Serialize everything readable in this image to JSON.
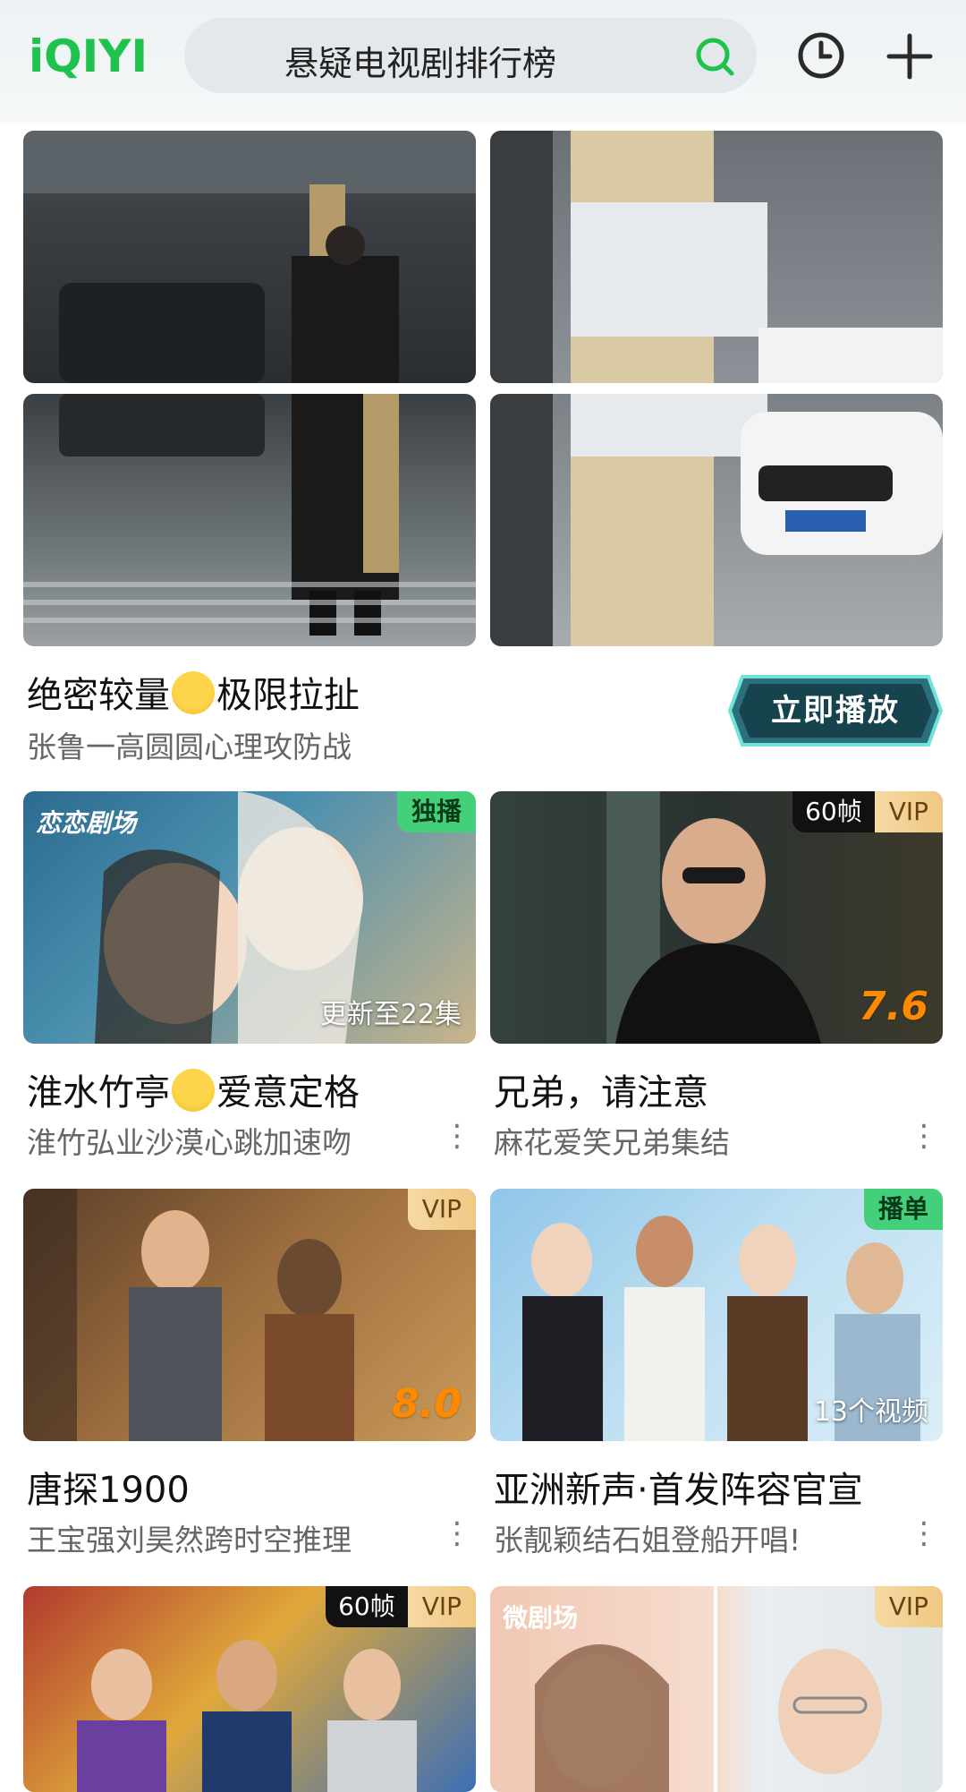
{
  "header": {
    "logo": "iQIYI",
    "search_text": "悬疑电视剧排行榜",
    "search_icon": "search-icon",
    "history_icon": "clock-icon",
    "add_icon": "plus-icon"
  },
  "featured": {
    "title_a": "绝密较量",
    "title_emoji": "fearful-face-emoji",
    "title_b": "极限拉扯",
    "subtitle": "张鲁一高圆圆心理攻防战",
    "play_button": "立即播放"
  },
  "cards": [
    {
      "title_a": "淮水竹亭",
      "emoji": "kissing-face-emoji",
      "title_b": "爱意定格",
      "subtitle": "淮竹弘业沙漠心跳加速吻",
      "badge": "独播",
      "overlay": "更新至22集",
      "logo": "恋恋剧场"
    },
    {
      "title": "兄弟，请注意",
      "subtitle": "麻花爱笑兄弟集结",
      "badge_fps": "60帧",
      "badge_vip": "VIP",
      "score": "7.6"
    },
    {
      "title": "唐探1900",
      "subtitle": "王宝强刘昊然跨时空推理",
      "badge_vip": "VIP",
      "score": "8.0"
    },
    {
      "title": "亚洲新声·首发阵容官宣",
      "subtitle": "张靓颖结石姐登船开唱!",
      "badge": "播单",
      "overlay": "13个视频"
    },
    {
      "badge_fps": "60帧",
      "badge_vip": "VIP"
    },
    {
      "badge_vip": "VIP",
      "logo": "微剧场"
    }
  ],
  "more_icon": "more-vertical-icon"
}
